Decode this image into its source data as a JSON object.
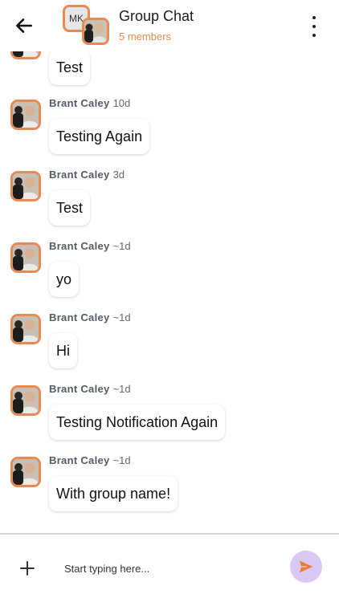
{
  "header": {
    "title": "Group Chat",
    "subtitle": "5 members",
    "group_initials": "MK"
  },
  "messages": [
    {
      "name": "",
      "time": "",
      "text": "Test"
    },
    {
      "name": "Brant Caley",
      "time": "10d",
      "text": "Testing Again"
    },
    {
      "name": "Brant Caley",
      "time": "3d",
      "text": "Test"
    },
    {
      "name": "Brant Caley",
      "time": "~1d",
      "text": "yo"
    },
    {
      "name": "Brant Caley",
      "time": "~1d",
      "text": "Hi"
    },
    {
      "name": "Brant Caley",
      "time": "~1d",
      "text": "Testing Notification Again"
    },
    {
      "name": "Brant Caley",
      "time": "~1d",
      "text": "With group name!"
    }
  ],
  "composer": {
    "placeholder": "Start typing here..."
  },
  "colors": {
    "accent": "#e88a55",
    "subtitle": "#e98a4c",
    "send_bg": "#d8c8f3",
    "send_icon": "#f07a2a"
  },
  "icons": {
    "back": "arrow-left-icon",
    "menu": "more-vertical-icon",
    "add": "plus-icon",
    "send": "send-icon"
  }
}
